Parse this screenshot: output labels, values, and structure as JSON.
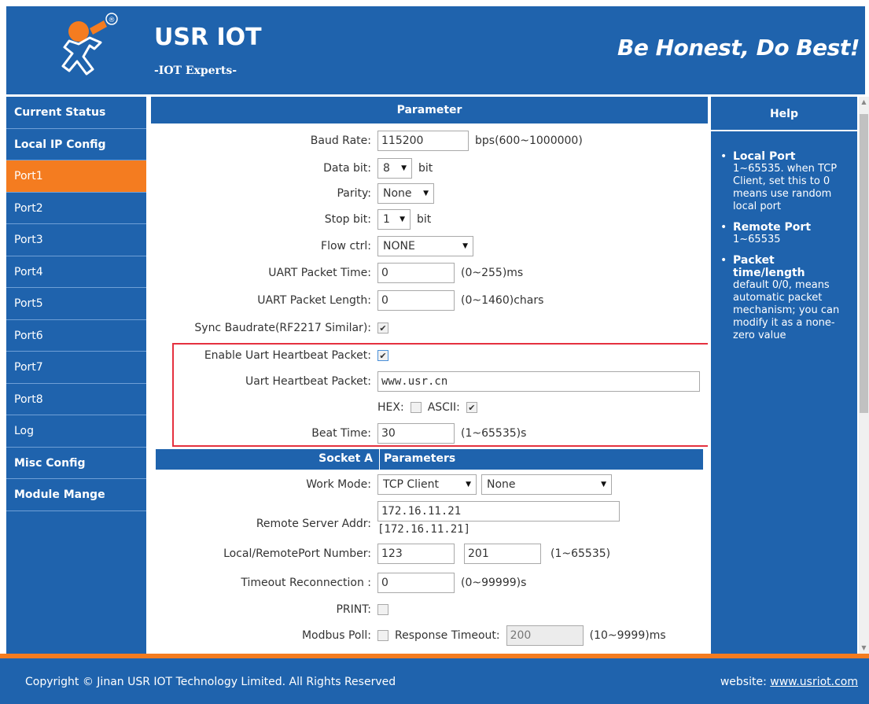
{
  "header": {
    "brand": "USR IOT",
    "brand_sub": "-IOT Experts-",
    "slogan": "Be Honest, Do Best!",
    "logo_mark": "®"
  },
  "sidebar": {
    "items": [
      {
        "label": "Current Status"
      },
      {
        "label": "Local IP Config"
      },
      {
        "label": "Port1"
      },
      {
        "label": "Port2"
      },
      {
        "label": "Port3"
      },
      {
        "label": "Port4"
      },
      {
        "label": "Port5"
      },
      {
        "label": "Port6"
      },
      {
        "label": "Port7"
      },
      {
        "label": "Port8"
      },
      {
        "label": "Log"
      },
      {
        "label": "Misc Config"
      },
      {
        "label": "Module Mange"
      }
    ]
  },
  "main": {
    "section_title": "Parameter",
    "baud_rate": {
      "label": "Baud Rate:",
      "value": "115200",
      "unit": "bps(600~1000000)"
    },
    "data_bit": {
      "label": "Data bit:",
      "value": "8",
      "unit": "bit"
    },
    "parity": {
      "label": "Parity:",
      "value": "None"
    },
    "stop_bit": {
      "label": "Stop bit:",
      "value": "1",
      "unit": "bit"
    },
    "flow_ctrl": {
      "label": "Flow ctrl:",
      "value": "NONE"
    },
    "uart_packet_time": {
      "label": "UART Packet Time:",
      "value": "0",
      "unit": "(0~255)ms"
    },
    "uart_packet_length": {
      "label": "UART Packet Length:",
      "value": "0",
      "unit": "(0~1460)chars"
    },
    "sync_baudrate": {
      "label": "Sync Baudrate(RF2217 Similar):"
    },
    "enable_heartbeat": {
      "label": "Enable Uart Heartbeat Packet:"
    },
    "heartbeat_packet": {
      "label": "Uart Heartbeat Packet:",
      "value": "www.usr.cn"
    },
    "hex_label": "HEX:",
    "ascii_label": "ASCII:",
    "beat_time": {
      "label": "Beat Time:",
      "value": "30",
      "unit": "(1~65535)s"
    },
    "socket_title_left": "Socket A",
    "socket_title_right": "Parameters",
    "work_mode": {
      "label": "Work Mode:",
      "value": "TCP Client",
      "value2": "None"
    },
    "remote_server": {
      "label": "Remote Server Addr:",
      "value": "172.16.11.21",
      "resolved": "[172.16.11.21]"
    },
    "port_number": {
      "label": "Local/RemotePort Number:",
      "local": "123",
      "remote": "201",
      "unit": "(1~65535)"
    },
    "timeout_reconnection": {
      "label": "Timeout Reconnection :",
      "value": "0",
      "unit": "(0~99999)s"
    },
    "print": {
      "label": "PRINT:"
    },
    "modbus_poll": {
      "label": "Modbus Poll:",
      "response_label": "Response Timeout:",
      "response_value": "200",
      "unit": "(10~9999)ms"
    }
  },
  "help": {
    "title": "Help",
    "items": [
      {
        "title": "Local Port",
        "text": "1~65535. when TCP Client, set this to 0 means use random local port"
      },
      {
        "title": "Remote Port",
        "text": "1~65535"
      },
      {
        "title": "Packet time/length",
        "text": "default 0/0, means automatic packet mechanism; you can modify it as a none-zero value"
      }
    ]
  },
  "footer": {
    "copyright": "Copyright © Jinan USR IOT Technology Limited. All Rights Reserved",
    "website_label": "website:",
    "website_link": "www.usriot.com"
  },
  "colors": {
    "primary": "#1f63ad",
    "accent": "#f47c20",
    "highlight_box": "#e5313f"
  }
}
